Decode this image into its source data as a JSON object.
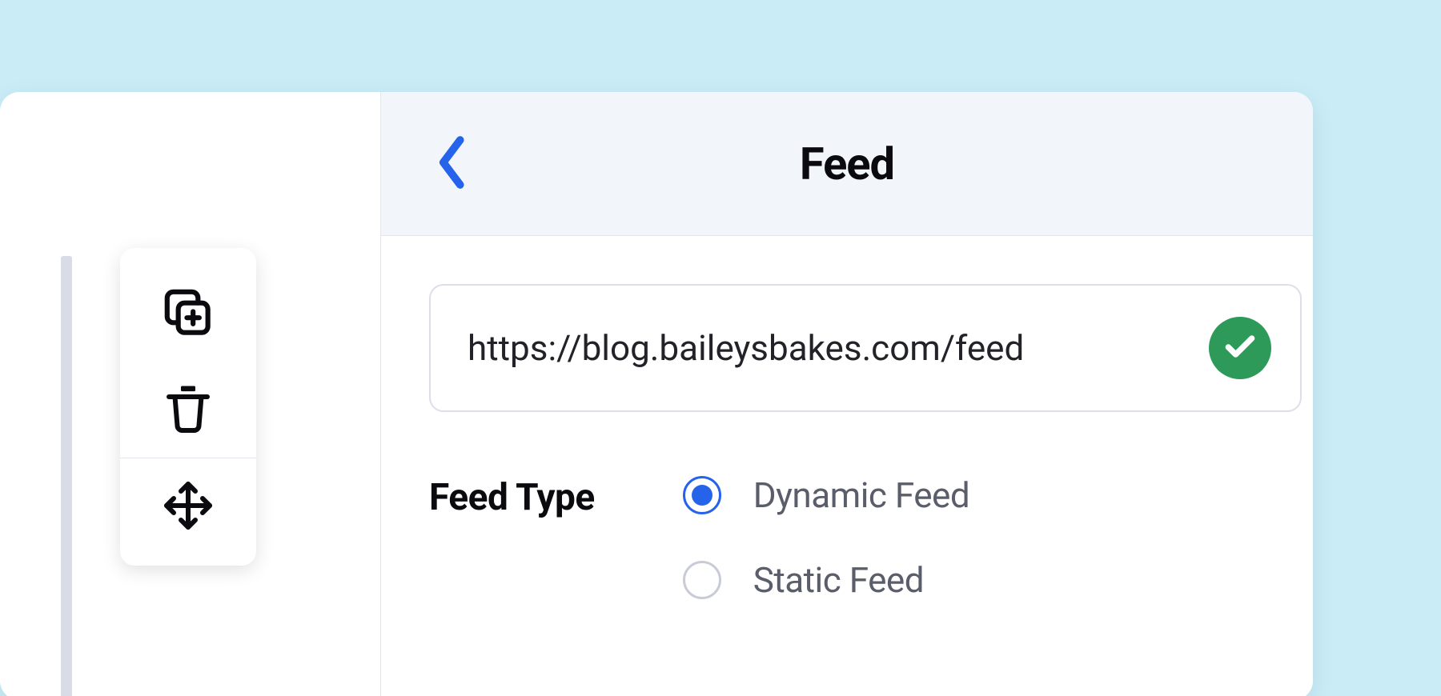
{
  "header": {
    "title": "Feed"
  },
  "toolbar": {
    "duplicate": "duplicate",
    "delete": "delete",
    "move": "move"
  },
  "feed": {
    "url": "https://blog.baileysbakes.com/feed",
    "url_valid": true,
    "type_label": "Feed Type",
    "options": [
      {
        "label": "Dynamic Feed",
        "selected": true
      },
      {
        "label": "Static Feed",
        "selected": false
      }
    ]
  },
  "colors": {
    "accent": "#2563eb",
    "success": "#2e9a59"
  }
}
